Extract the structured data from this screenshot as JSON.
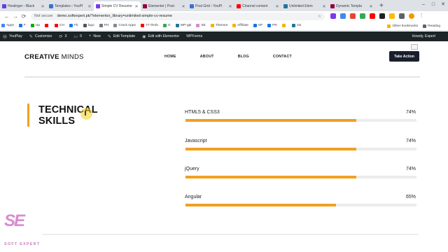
{
  "browser": {
    "tabs": [
      {
        "title": "Hostinger - Black",
        "color": "#673de6"
      },
      {
        "title": "Templates ‹ YouPl",
        "color": "#3c6fd6"
      },
      {
        "title": "Simple CV Resume",
        "color": "#7c3aed",
        "active": true
      },
      {
        "title": "Elementor | Post",
        "color": "#92003b"
      },
      {
        "title": "Post Grid ‹ YouPl",
        "color": "#3c6fd6"
      },
      {
        "title": "Channel content",
        "color": "#ff0000"
      },
      {
        "title": "Unlimited Elem",
        "color": "#21759b"
      },
      {
        "title": "Dynamic Templa",
        "color": "#92003b"
      }
    ],
    "new_tab": "+",
    "window_controls": [
      "–",
      "□",
      "✕"
    ],
    "address": {
      "security_label": "Not secure",
      "url": "demo.softexpert.pk/?elementor_library=unlimited-simple-cv-resume"
    },
    "bookmarks": [
      {
        "label": "Apps",
        "color": "#4285f4"
      },
      {
        "label": "F",
        "color": "#1877f2"
      },
      {
        "label": "Up",
        "color": "#14a800"
      },
      {
        "label": "",
        "color": "#ff0000"
      },
      {
        "label": "CH",
        "color": "#ff0000"
      },
      {
        "label": "Fb",
        "color": "#1877f2"
      },
      {
        "label": "logo",
        "color": "#555555"
      },
      {
        "label": "PH",
        "color": "#777777"
      },
      {
        "label": "Crack Apps",
        "color": "#888888"
      },
      {
        "label": "YT thmb",
        "color": "#ff0000"
      },
      {
        "label": "G",
        "color": "#34a853"
      },
      {
        "label": "WP-gpl",
        "color": "#21759b"
      },
      {
        "label": "SE",
        "color": "#d98bd0"
      },
      {
        "label": "Themes",
        "color": "#f4b400"
      },
      {
        "label": "Affiliate",
        "color": "#f4b400"
      },
      {
        "label": "SP",
        "color": "#1a73e8"
      },
      {
        "label": "PR",
        "color": "#1a73e8"
      },
      {
        "label": "",
        "color": "#f4b400"
      },
      {
        "label": "1st",
        "color": "#21759b"
      }
    ],
    "bookmarks_right": [
      "Other bookmarks",
      "Reading"
    ]
  },
  "wp_admin": {
    "site": "YouPlay",
    "customize": "Customize",
    "updates": "3",
    "comments": "0",
    "new": "New",
    "edit_template": "Edit Template",
    "edit_elementor": "Edit with Elementor",
    "wpforms": "WPForms",
    "howdy": "Howdy, Expert"
  },
  "site": {
    "logo_bold": "CREATIVE",
    "logo_light": " MINDS",
    "nav": [
      "HOME",
      "ABOUT",
      "BLOG",
      "CONTACT"
    ],
    "cta": "Take Action"
  },
  "skills_section": {
    "heading_line1": "TECHNICAL",
    "heading_line2": "SKILLS",
    "accent_color": "#f0a020",
    "skills": [
      {
        "name": "HTML5 & CSS3",
        "percent_label": "74%",
        "value": 74
      },
      {
        "name": "Javascript",
        "percent_label": "74%",
        "value": 74
      },
      {
        "name": "jQuery",
        "percent_label": "74%",
        "value": 74
      },
      {
        "name": "Angular",
        "percent_label": "65%",
        "value": 65
      }
    ]
  },
  "watermark": {
    "mark": "SE",
    "text": "SOFT EXPERT"
  }
}
